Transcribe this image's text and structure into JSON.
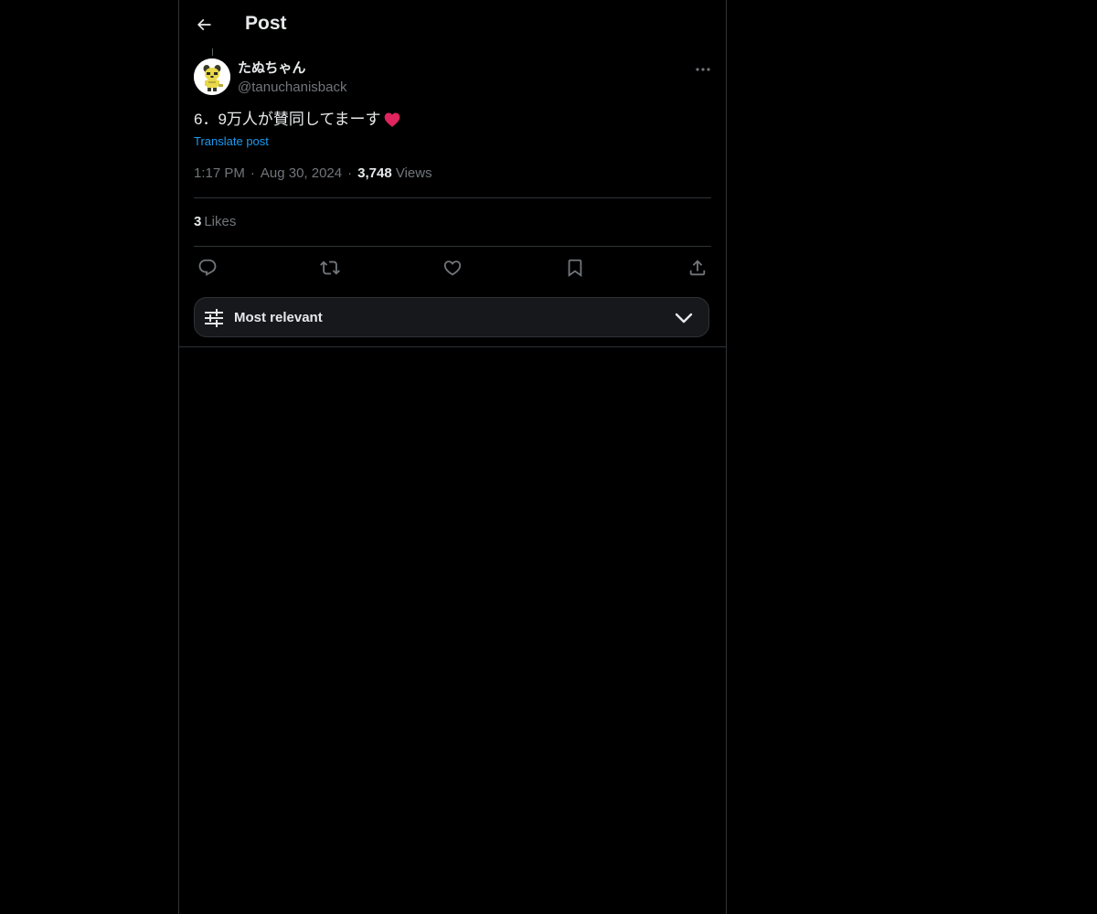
{
  "header": {
    "title": "Post"
  },
  "post": {
    "author": {
      "display_name": "たぬちゃん",
      "handle": "@tanuchanisback"
    },
    "text": "6．9万人が賛同してまーす",
    "emoji": "red-heart",
    "translate_label": "Translate post",
    "time": "1:17 PM",
    "date": "Aug 30, 2024",
    "views_count": "3,748",
    "views_label": "Views",
    "likes_count": "3",
    "likes_label": "Likes"
  },
  "actions": {
    "reply": "reply-icon",
    "repost": "repost-icon",
    "like": "heart-icon",
    "bookmark": "bookmark-icon",
    "share": "share-icon"
  },
  "sort": {
    "label": "Most relevant"
  },
  "colors": {
    "background": "#000000",
    "text": "#e7e9ea",
    "secondary": "#71767b",
    "link": "#1d9bf0",
    "border": "#2f3336",
    "heart": "#e0245e"
  }
}
